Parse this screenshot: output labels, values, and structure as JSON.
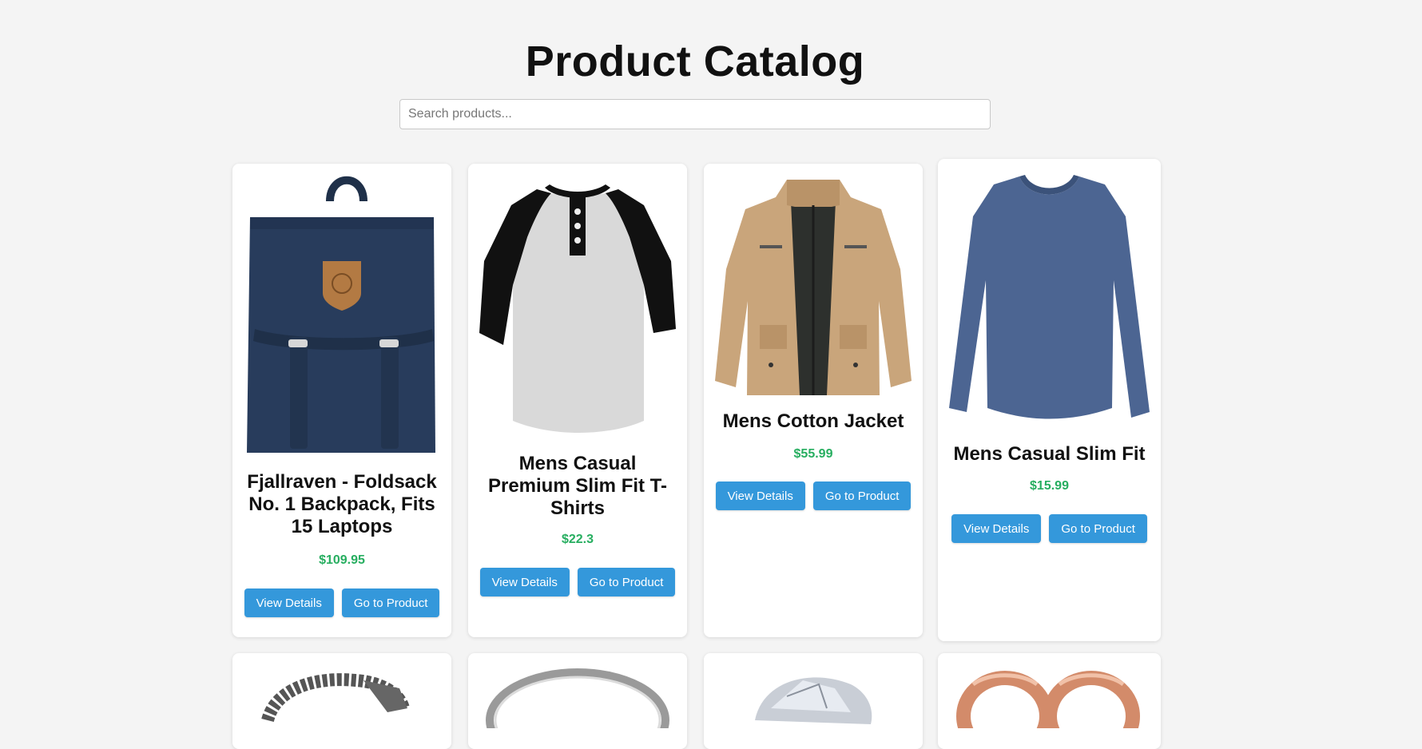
{
  "page": {
    "title": "Product Catalog",
    "search_placeholder": "Search products..."
  },
  "buttons": {
    "view_details": "View Details",
    "go_to_product": "Go to Product"
  },
  "colors": {
    "background": "#f4f4f4",
    "price": "#27ae60",
    "button": "#3498db"
  },
  "products": [
    {
      "title": "Fjallraven - Foldsack No. 1 Backpack, Fits 15 Laptops",
      "price": "$109.95",
      "image": "backpack"
    },
    {
      "title": "Mens Casual Premium Slim Fit T-Shirts",
      "price": "$22.3",
      "image": "raglan-tshirt"
    },
    {
      "title": "Mens Cotton Jacket",
      "price": "$55.99",
      "image": "cotton-jacket"
    },
    {
      "title": "Mens Casual Slim Fit",
      "price": "$15.99",
      "image": "long-sleeve-shirt"
    },
    {
      "image": "dragon-bracelet"
    },
    {
      "image": "silver-ring"
    },
    {
      "image": "diamond-ring"
    },
    {
      "image": "rose-gold-earrings"
    }
  ]
}
